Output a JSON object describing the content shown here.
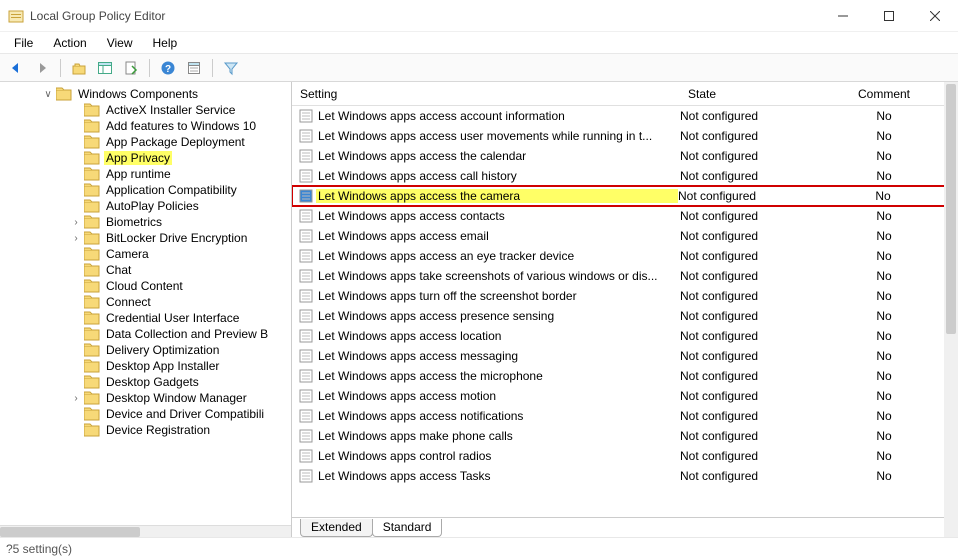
{
  "window": {
    "title": "Local Group Policy Editor"
  },
  "menu": {
    "items": [
      "File",
      "Action",
      "View",
      "Help"
    ]
  },
  "tree": {
    "parent": {
      "label": "Windows Components",
      "expanded": true,
      "highlighted": false
    },
    "children": [
      {
        "label": "ActiveX Installer Service",
        "expandable": false
      },
      {
        "label": "Add features to Windows 10",
        "expandable": false
      },
      {
        "label": "App Package Deployment",
        "expandable": false
      },
      {
        "label": "App Privacy",
        "expandable": false,
        "highlighted": true
      },
      {
        "label": "App runtime",
        "expandable": false
      },
      {
        "label": "Application Compatibility",
        "expandable": false
      },
      {
        "label": "AutoPlay Policies",
        "expandable": false
      },
      {
        "label": "Biometrics",
        "expandable": true
      },
      {
        "label": "BitLocker Drive Encryption",
        "expandable": true
      },
      {
        "label": "Camera",
        "expandable": false
      },
      {
        "label": "Chat",
        "expandable": false
      },
      {
        "label": "Cloud Content",
        "expandable": false
      },
      {
        "label": "Connect",
        "expandable": false
      },
      {
        "label": "Credential User Interface",
        "expandable": false
      },
      {
        "label": "Data Collection and Preview B",
        "expandable": false
      },
      {
        "label": "Delivery Optimization",
        "expandable": false
      },
      {
        "label": "Desktop App Installer",
        "expandable": false
      },
      {
        "label": "Desktop Gadgets",
        "expandable": false
      },
      {
        "label": "Desktop Window Manager",
        "expandable": true
      },
      {
        "label": "Device and Driver Compatibili",
        "expandable": false
      },
      {
        "label": "Device Registration",
        "expandable": false
      }
    ]
  },
  "list": {
    "columns": {
      "setting": "Setting",
      "state": "State",
      "comment": "Comment"
    },
    "rows": [
      {
        "setting": "Let Windows apps access account information",
        "state": "Not configured",
        "comment": "No",
        "selected": false
      },
      {
        "setting": "Let Windows apps access user movements while running in t...",
        "state": "Not configured",
        "comment": "No",
        "selected": false
      },
      {
        "setting": "Let Windows apps access the calendar",
        "state": "Not configured",
        "comment": "No",
        "selected": false
      },
      {
        "setting": "Let Windows apps access call history",
        "state": "Not configured",
        "comment": "No",
        "selected": false
      },
      {
        "setting": "Let Windows apps access the camera",
        "state": "Not configured",
        "comment": "No",
        "selected": true
      },
      {
        "setting": "Let Windows apps access contacts",
        "state": "Not configured",
        "comment": "No",
        "selected": false
      },
      {
        "setting": "Let Windows apps access email",
        "state": "Not configured",
        "comment": "No",
        "selected": false
      },
      {
        "setting": "Let Windows apps access an eye tracker device",
        "state": "Not configured",
        "comment": "No",
        "selected": false
      },
      {
        "setting": "Let Windows apps take screenshots of various windows or dis...",
        "state": "Not configured",
        "comment": "No",
        "selected": false
      },
      {
        "setting": "Let Windows apps turn off the screenshot border",
        "state": "Not configured",
        "comment": "No",
        "selected": false
      },
      {
        "setting": "Let Windows apps access presence sensing",
        "state": "Not configured",
        "comment": "No",
        "selected": false
      },
      {
        "setting": "Let Windows apps access location",
        "state": "Not configured",
        "comment": "No",
        "selected": false
      },
      {
        "setting": "Let Windows apps access messaging",
        "state": "Not configured",
        "comment": "No",
        "selected": false
      },
      {
        "setting": "Let Windows apps access the microphone",
        "state": "Not configured",
        "comment": "No",
        "selected": false
      },
      {
        "setting": "Let Windows apps access motion",
        "state": "Not configured",
        "comment": "No",
        "selected": false
      },
      {
        "setting": "Let Windows apps access notifications",
        "state": "Not configured",
        "comment": "No",
        "selected": false
      },
      {
        "setting": "Let Windows apps make phone calls",
        "state": "Not configured",
        "comment": "No",
        "selected": false
      },
      {
        "setting": "Let Windows apps control radios",
        "state": "Not configured",
        "comment": "No",
        "selected": false
      },
      {
        "setting": "Let Windows apps access Tasks",
        "state": "Not configured",
        "comment": "No",
        "selected": false
      }
    ],
    "tabs": {
      "extended": "Extended",
      "standard": "Standard"
    }
  },
  "status": {
    "text": "?5 setting(s)"
  }
}
